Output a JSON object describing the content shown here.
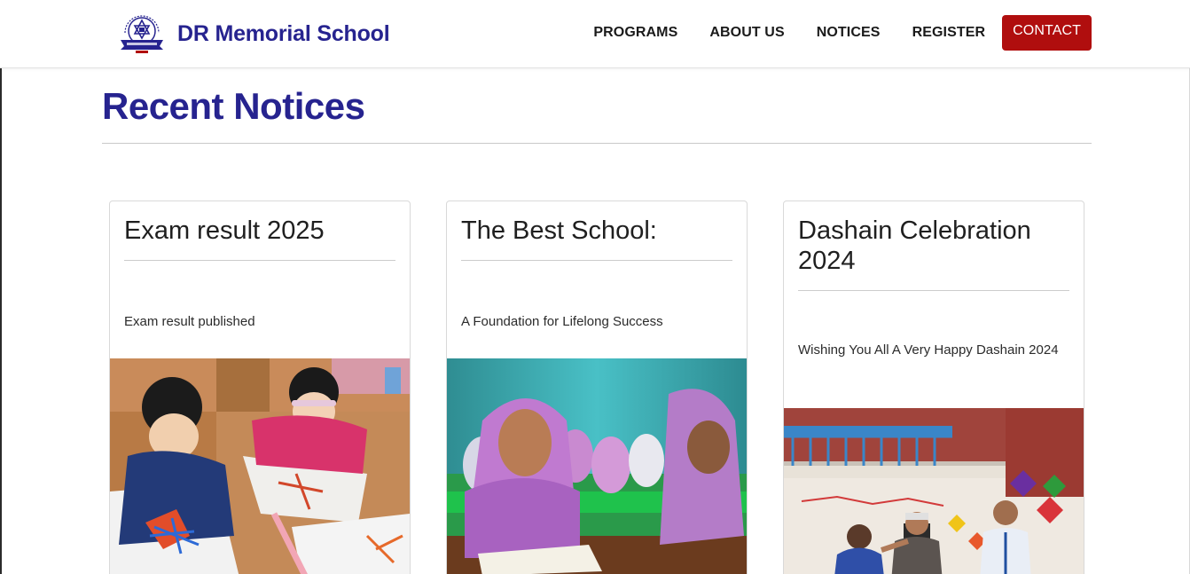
{
  "header": {
    "brand": "DR Memorial School",
    "logo_icon": "school-emblem-icon",
    "nav": [
      "PROGRAMS",
      "ABOUT US",
      "NOTICES",
      "REGISTER"
    ],
    "contact_label": "CONTACT",
    "contact_color": "#b00e0e",
    "brand_color": "#26238f"
  },
  "main": {
    "title": "Recent Notices",
    "notices": [
      {
        "title": "Exam result 2025",
        "summary": "Exam result published",
        "image": "children-painting-photo"
      },
      {
        "title": "The Best School:",
        "summary": "A Foundation for Lifelong Success",
        "image": "student-reading-photo"
      },
      {
        "title": "Dashain Celebration 2024",
        "summary": "Wishing You All A Very Happy Dashain 2024",
        "image": "dashain-celebration-photo"
      }
    ]
  }
}
